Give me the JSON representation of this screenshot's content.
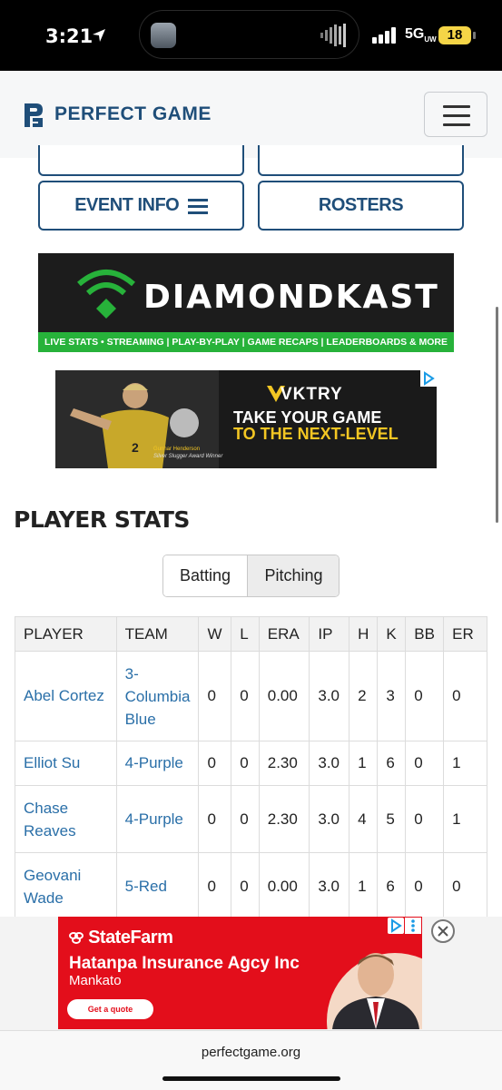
{
  "status_bar": {
    "time": "3:21",
    "network": "5G",
    "network_sup": "UW",
    "battery": "18"
  },
  "header": {
    "logo_text": "PERFECT GAME",
    "menu_icon": "hamburger-icon"
  },
  "nav": {
    "event_info_label": "EVENT INFO",
    "rosters_label": "ROSTERS"
  },
  "ad_diamondkast": {
    "brand": "DIAMONDKAST",
    "tagline": "LIVE STATS • STREAMING | PLAY-BY-PLAY | GAME RECAPS | LEADERBOARDS & MORE"
  },
  "ad_vktry": {
    "brand": "VKTRY",
    "line1": "TAKE YOUR GAME",
    "line2": "TO THE NEXT-LEVEL",
    "caption_name": "Gunnar Henderson",
    "caption_award": "Silver Slugger Award Winner",
    "jersey": "2"
  },
  "section_title": "PLAYER STATS",
  "toggle": {
    "batting": "Batting",
    "pitching": "Pitching",
    "selected": "Pitching"
  },
  "table": {
    "columns": [
      "PLAYER",
      "TEAM",
      "W",
      "L",
      "ERA",
      "IP",
      "H",
      "K",
      "BB",
      "ER"
    ],
    "rows": [
      [
        "Abel Cortez",
        "3-Columbia Blue",
        "0",
        "0",
        "0.00",
        "3.0",
        "2",
        "3",
        "0",
        "0"
      ],
      [
        "Elliot Su",
        "4-Purple",
        "0",
        "0",
        "2.30",
        "3.0",
        "1",
        "6",
        "0",
        "1"
      ],
      [
        "Chase Reaves",
        "4-Purple",
        "0",
        "0",
        "2.30",
        "3.0",
        "4",
        "5",
        "0",
        "1"
      ],
      [
        "Geovani Wade",
        "5-Red",
        "0",
        "0",
        "0.00",
        "3.0",
        "1",
        "6",
        "0",
        "0"
      ]
    ]
  },
  "statefarm_ad": {
    "logo": "StateFarm",
    "agency": "Hatanpa Insurance Agcy Inc",
    "city": "Mankato",
    "cta": "Get a quote"
  },
  "url_bar": {
    "url": "perfectgame.org"
  },
  "colors": {
    "brand_blue": "#1f4e79",
    "link_blue": "#2a6fa8",
    "statefarm_red": "#e30e1b",
    "dk_green": "#27b23a",
    "vktry_gold": "#f3c623"
  }
}
